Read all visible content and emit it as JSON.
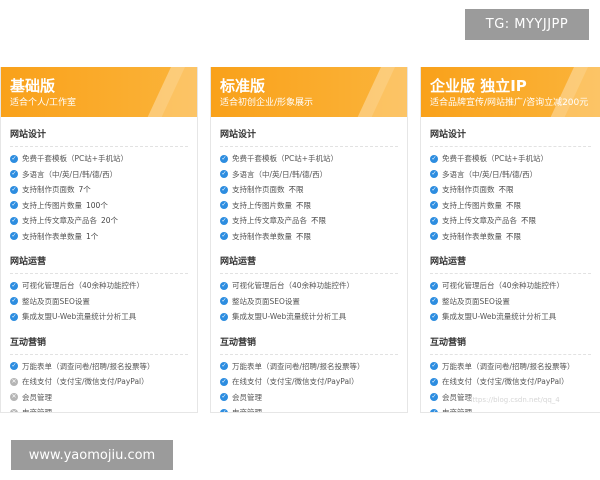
{
  "plans": [
    {
      "title": "基础版",
      "subtitle": "适合个人/工作室",
      "sections": [
        {
          "title": "网站设计",
          "items": [
            {
              "label": "免费千套模板（PC站+手机站）",
              "value": "",
              "included": true
            },
            {
              "label": "多语言（中/英/日/韩/德/西）",
              "value": "",
              "included": true
            },
            {
              "label": "支持制作页面数",
              "value": "7个",
              "included": true
            },
            {
              "label": "支持上传图片数量",
              "value": "100个",
              "included": true
            },
            {
              "label": "支持上传文章及产品各",
              "value": "20个",
              "included": true
            },
            {
              "label": "支持制作表单数量",
              "value": "1个",
              "included": true
            }
          ]
        },
        {
          "title": "网站运营",
          "items": [
            {
              "label": "可视化管理后台（40余种功能控件）",
              "value": "",
              "included": true
            },
            {
              "label": "整站及页面SEO设置",
              "value": "",
              "included": true
            },
            {
              "label": "集成友盟U-Web流量统计分析工具",
              "value": "",
              "included": true
            }
          ]
        },
        {
          "title": "互动营销",
          "items": [
            {
              "label": "万能表单（调查问卷/招聘/报名投票等）",
              "value": "",
              "included": true
            },
            {
              "label": "在线支付（支付宝/微信支付/PayPal）",
              "value": "",
              "included": false
            },
            {
              "label": "会员管理",
              "value": "",
              "included": false
            },
            {
              "label": "电商管理",
              "value": "",
              "included": false
            }
          ]
        }
      ]
    },
    {
      "title": "标准版",
      "subtitle": "适合初创企业/形象展示",
      "sections": [
        {
          "title": "网站设计",
          "items": [
            {
              "label": "免费千套模板（PC站+手机站）",
              "value": "",
              "included": true
            },
            {
              "label": "多语言（中/英/日/韩/德/西）",
              "value": "",
              "included": true
            },
            {
              "label": "支持制作页面数",
              "value": "不限",
              "included": true
            },
            {
              "label": "支持上传图片数量",
              "value": "不限",
              "included": true
            },
            {
              "label": "支持上传文章及产品各",
              "value": "不限",
              "included": true
            },
            {
              "label": "支持制作表单数量",
              "value": "不限",
              "included": true
            }
          ]
        },
        {
          "title": "网站运营",
          "items": [
            {
              "label": "可视化管理后台（40余种功能控件）",
              "value": "",
              "included": true
            },
            {
              "label": "整站及页面SEO设置",
              "value": "",
              "included": true
            },
            {
              "label": "集成友盟U-Web流量统计分析工具",
              "value": "",
              "included": true
            }
          ]
        },
        {
          "title": "互动营销",
          "items": [
            {
              "label": "万能表单（调查问卷/招聘/报名投票等）",
              "value": "",
              "included": true
            },
            {
              "label": "在线支付（支付宝/微信支付/PayPal）",
              "value": "",
              "included": true
            },
            {
              "label": "会员管理",
              "value": "",
              "included": true
            },
            {
              "label": "电商管理",
              "value": "",
              "included": true
            }
          ]
        }
      ]
    },
    {
      "title": "企业版 独立IP",
      "subtitle": "适合品牌宣传/网站推广/咨询立减200元",
      "sections": [
        {
          "title": "网站设计",
          "items": [
            {
              "label": "免费千套模板（PC站+手机站）",
              "value": "",
              "included": true
            },
            {
              "label": "多语言（中/英/日/韩/德/西）",
              "value": "",
              "included": true
            },
            {
              "label": "支持制作页面数",
              "value": "不限",
              "included": true
            },
            {
              "label": "支持上传图片数量",
              "value": "不限",
              "included": true
            },
            {
              "label": "支持上传文章及产品各",
              "value": "不限",
              "included": true
            },
            {
              "label": "支持制作表单数量",
              "value": "不限",
              "included": true
            }
          ]
        },
        {
          "title": "网站运营",
          "items": [
            {
              "label": "可视化管理后台（40余种功能控件）",
              "value": "",
              "included": true
            },
            {
              "label": "整站及页面SEO设置",
              "value": "",
              "included": true
            },
            {
              "label": "集成友盟U-Web流量统计分析工具",
              "value": "",
              "included": true
            }
          ]
        },
        {
          "title": "互动营销",
          "items": [
            {
              "label": "万能表单（调查问卷/招聘/报名投票等）",
              "value": "",
              "included": true
            },
            {
              "label": "在线支付（支付宝/微信支付/PayPal）",
              "value": "",
              "included": true
            },
            {
              "label": "会员管理",
              "value": "",
              "included": true
            },
            {
              "label": "电商管理",
              "value": "",
              "included": true
            }
          ]
        }
      ]
    }
  ],
  "icons": {
    "included": "check-circle-icon",
    "excluded": "cross-circle-icon"
  },
  "colors": {
    "header_orange": "#f9a11a",
    "check_blue": "#2d8de0",
    "excluded_gray": "#b5b5b5"
  },
  "overlays": {
    "tg_badge": "TG: MYYJJPP",
    "site_badge": "www.yaomojiu.com",
    "watermark": "https://blog.csdn.net/qq_4"
  }
}
